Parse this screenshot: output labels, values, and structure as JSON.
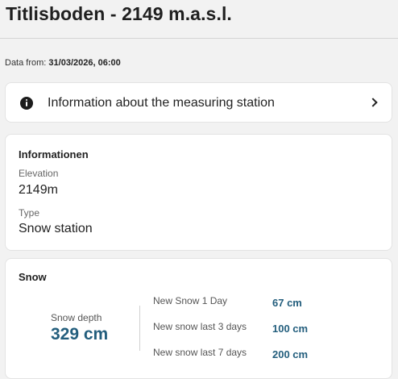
{
  "page": {
    "title": "Titlisboden - 2149 m.a.s.l.",
    "data_from_label": "Data from:",
    "data_from_value": "31/03/2026, 06:00"
  },
  "station_info_link": {
    "label": "Information about the measuring station",
    "icon": "info-icon",
    "chevron_icon": "chevron-right-icon"
  },
  "informationen": {
    "title": "Informationen",
    "fields": [
      {
        "label": "Elevation",
        "value": "2149m"
      },
      {
        "label": "Type",
        "value": "Snow station"
      }
    ]
  },
  "snow": {
    "title": "Snow",
    "depth_label": "Snow depth",
    "depth_value": "329 cm",
    "new_snow": [
      {
        "label": "New Snow 1 Day",
        "value": "67 cm"
      },
      {
        "label": "New snow last 3 days",
        "value": "100 cm"
      },
      {
        "label": "New snow last 7 days",
        "value": "200 cm"
      }
    ]
  },
  "colors": {
    "accent": "#235e7d",
    "background": "#f2f2f2",
    "card": "#ffffff"
  }
}
